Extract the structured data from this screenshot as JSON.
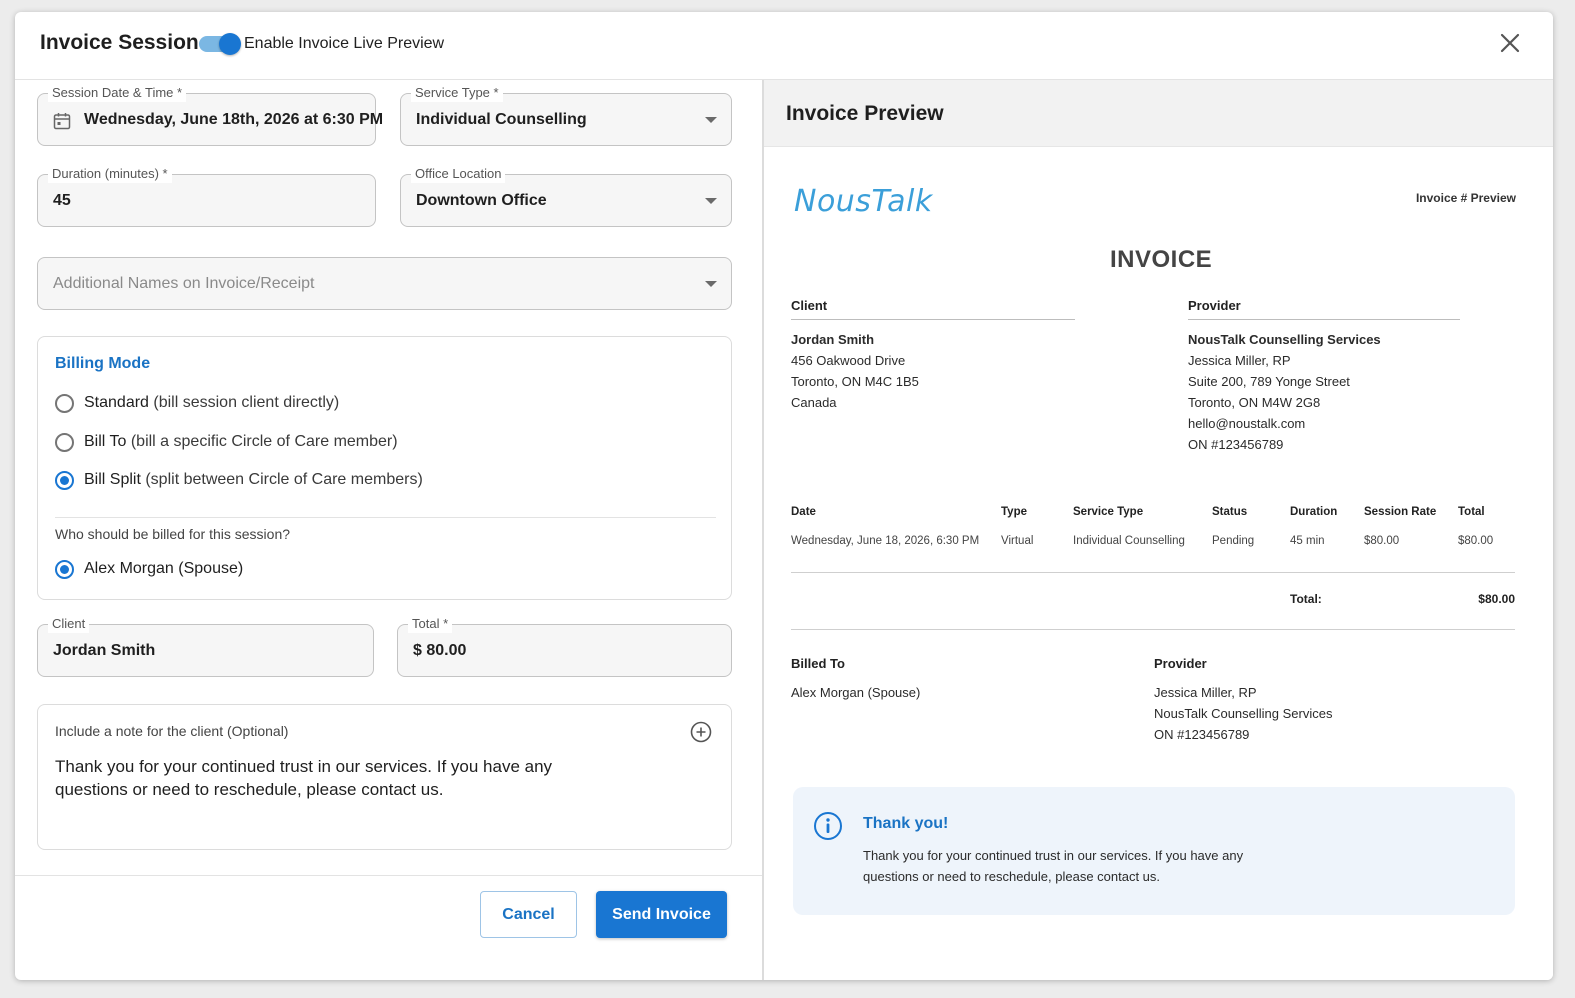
{
  "header": {
    "title": "Invoice Session",
    "toggle_label": "Enable Invoice Live Preview",
    "toggle_on": true
  },
  "form": {
    "session_date": {
      "label": "Session Date & Time *",
      "value": "Wednesday, June 18th, 2026 at 6:30 PM"
    },
    "service_type": {
      "label": "Service Type *",
      "value": "Individual Counselling"
    },
    "duration": {
      "label": "Duration (minutes) *",
      "value": "45"
    },
    "office_location": {
      "label": "Office Location",
      "value": "Downtown Office"
    },
    "additional_names": {
      "placeholder": "Additional Names on Invoice/Receipt"
    },
    "billing": {
      "title": "Billing Mode",
      "options": [
        {
          "strong": "Standard",
          "rest": " (bill session client directly)",
          "selected": false
        },
        {
          "strong": "Bill To",
          "rest": " (bill a specific Circle of Care member)",
          "selected": false
        },
        {
          "strong": "Bill Split",
          "rest": " (split between Circle of Care members)",
          "selected": true
        }
      ],
      "question": "Who should be billed for this session?",
      "billed_member": {
        "label": "Alex Morgan (Spouse)",
        "selected": true
      }
    },
    "client": {
      "label": "Client",
      "value": "Jordan Smith"
    },
    "total": {
      "label": "Total *",
      "value": "$ 80.00"
    },
    "note": {
      "label": "Include a note for the client (Optional)",
      "text": "Thank you for your continued trust in our services. If you have any questions or need to reschedule, please contact us."
    },
    "cancel_label": "Cancel",
    "send_label": "Send Invoice"
  },
  "preview": {
    "title": "Invoice Preview",
    "logo_text": "NousTalk",
    "invoice_number": "Invoice # Preview",
    "invoice_heading": "INVOICE",
    "client": {
      "heading": "Client",
      "name": "Jordan Smith",
      "line1": "456 Oakwood Drive",
      "line2": "Toronto, ON M4C 1B5",
      "line3": "Canada"
    },
    "provider": {
      "heading": "Provider",
      "name": "NousTalk Counselling Services",
      "line1": "Jessica Miller, RP",
      "line2": "Suite 200, 789 Yonge Street",
      "line3": "Toronto, ON M4W 2G8",
      "line4": "hello@noustalk.com",
      "line5": "ON #123456789"
    },
    "table": {
      "headers": [
        "Date",
        "Type",
        "Service Type",
        "Status",
        "Duration",
        "Session Rate",
        "Total"
      ],
      "row": [
        "Wednesday, June 18, 2026, 6:30 PM",
        "Virtual",
        "Individual Counselling",
        "Pending",
        "45 min",
        "$80.00",
        "$80.00"
      ]
    },
    "total_label": "Total:",
    "total_value": "$80.00",
    "billed_to": {
      "heading": "Billed To",
      "name": "Alex Morgan (Spouse)"
    },
    "provider_footer": {
      "heading": "Provider",
      "line1": "Jessica Miller, RP",
      "line2": "NousTalk Counselling Services",
      "line3": "ON #123456789"
    },
    "thanks": {
      "title": "Thank you!",
      "text": "Thank you for your continued trust in our services. If you have any questions or need to reschedule, please contact us."
    }
  },
  "colors": {
    "accent": "#1976d2",
    "link": "#1a73c4",
    "logo": "#3b9fd9",
    "thanks_bg": "#eef4fb"
  }
}
